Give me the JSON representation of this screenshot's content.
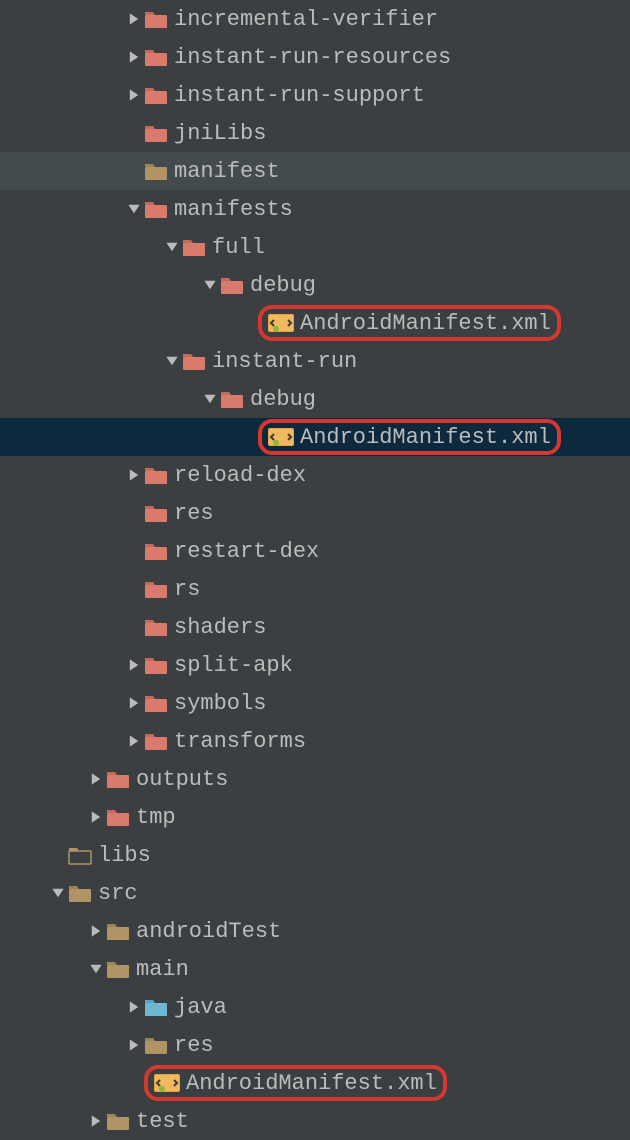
{
  "tree": {
    "items": [
      {
        "label": "incremental-verifier",
        "indent": 3,
        "arrow": "right",
        "icon": "folder-red"
      },
      {
        "label": "instant-run-resources",
        "indent": 3,
        "arrow": "right",
        "icon": "folder-red"
      },
      {
        "label": "instant-run-support",
        "indent": 3,
        "arrow": "right",
        "icon": "folder-red"
      },
      {
        "label": "jniLibs",
        "indent": 3,
        "arrow": "none",
        "icon": "folder-red"
      },
      {
        "label": "manifest",
        "indent": 3,
        "arrow": "none",
        "icon": "folder-tan",
        "rowClass": "row-manifest"
      },
      {
        "label": "manifests",
        "indent": 3,
        "arrow": "down",
        "icon": "folder-red"
      },
      {
        "label": "full",
        "indent": 4,
        "arrow": "down",
        "icon": "folder-red"
      },
      {
        "label": "debug",
        "indent": 5,
        "arrow": "down",
        "icon": "folder-red"
      },
      {
        "label": "AndroidManifest.xml",
        "indent": 6,
        "arrow": "none",
        "icon": "xml",
        "highlight": true
      },
      {
        "label": "instant-run",
        "indent": 4,
        "arrow": "down",
        "icon": "folder-red"
      },
      {
        "label": "debug",
        "indent": 5,
        "arrow": "down",
        "icon": "folder-red"
      },
      {
        "label": "AndroidManifest.xml",
        "indent": 6,
        "arrow": "none",
        "icon": "xml",
        "highlight": true,
        "rowClass": "row-selected"
      },
      {
        "label": "reload-dex",
        "indent": 3,
        "arrow": "right",
        "icon": "folder-red"
      },
      {
        "label": "res",
        "indent": 3,
        "arrow": "none",
        "icon": "folder-red"
      },
      {
        "label": "restart-dex",
        "indent": 3,
        "arrow": "none",
        "icon": "folder-red"
      },
      {
        "label": "rs",
        "indent": 3,
        "arrow": "none",
        "icon": "folder-red"
      },
      {
        "label": "shaders",
        "indent": 3,
        "arrow": "none",
        "icon": "folder-red"
      },
      {
        "label": "split-apk",
        "indent": 3,
        "arrow": "right",
        "icon": "folder-red"
      },
      {
        "label": "symbols",
        "indent": 3,
        "arrow": "right",
        "icon": "folder-red"
      },
      {
        "label": "transforms",
        "indent": 3,
        "arrow": "right",
        "icon": "folder-red"
      },
      {
        "label": "outputs",
        "indent": 2,
        "arrow": "right",
        "icon": "folder-red"
      },
      {
        "label": "tmp",
        "indent": 2,
        "arrow": "right",
        "icon": "folder-red"
      },
      {
        "label": "libs",
        "indent": 1,
        "arrow": "none",
        "icon": "folder-empty"
      },
      {
        "label": "src",
        "indent": 1,
        "arrow": "down",
        "icon": "folder-tan"
      },
      {
        "label": "androidTest",
        "indent": 2,
        "arrow": "right",
        "icon": "folder-tan"
      },
      {
        "label": "main",
        "indent": 2,
        "arrow": "down",
        "icon": "folder-tan"
      },
      {
        "label": "java",
        "indent": 3,
        "arrow": "right",
        "icon": "folder-blue"
      },
      {
        "label": "res",
        "indent": 3,
        "arrow": "right",
        "icon": "folder-res"
      },
      {
        "label": "AndroidManifest.xml",
        "indent": 3,
        "arrow": "none",
        "icon": "xml",
        "highlight": true
      },
      {
        "label": "test",
        "indent": 2,
        "arrow": "right",
        "icon": "folder-tan"
      }
    ]
  },
  "indentPx": 38,
  "baseIndentPx": 10
}
